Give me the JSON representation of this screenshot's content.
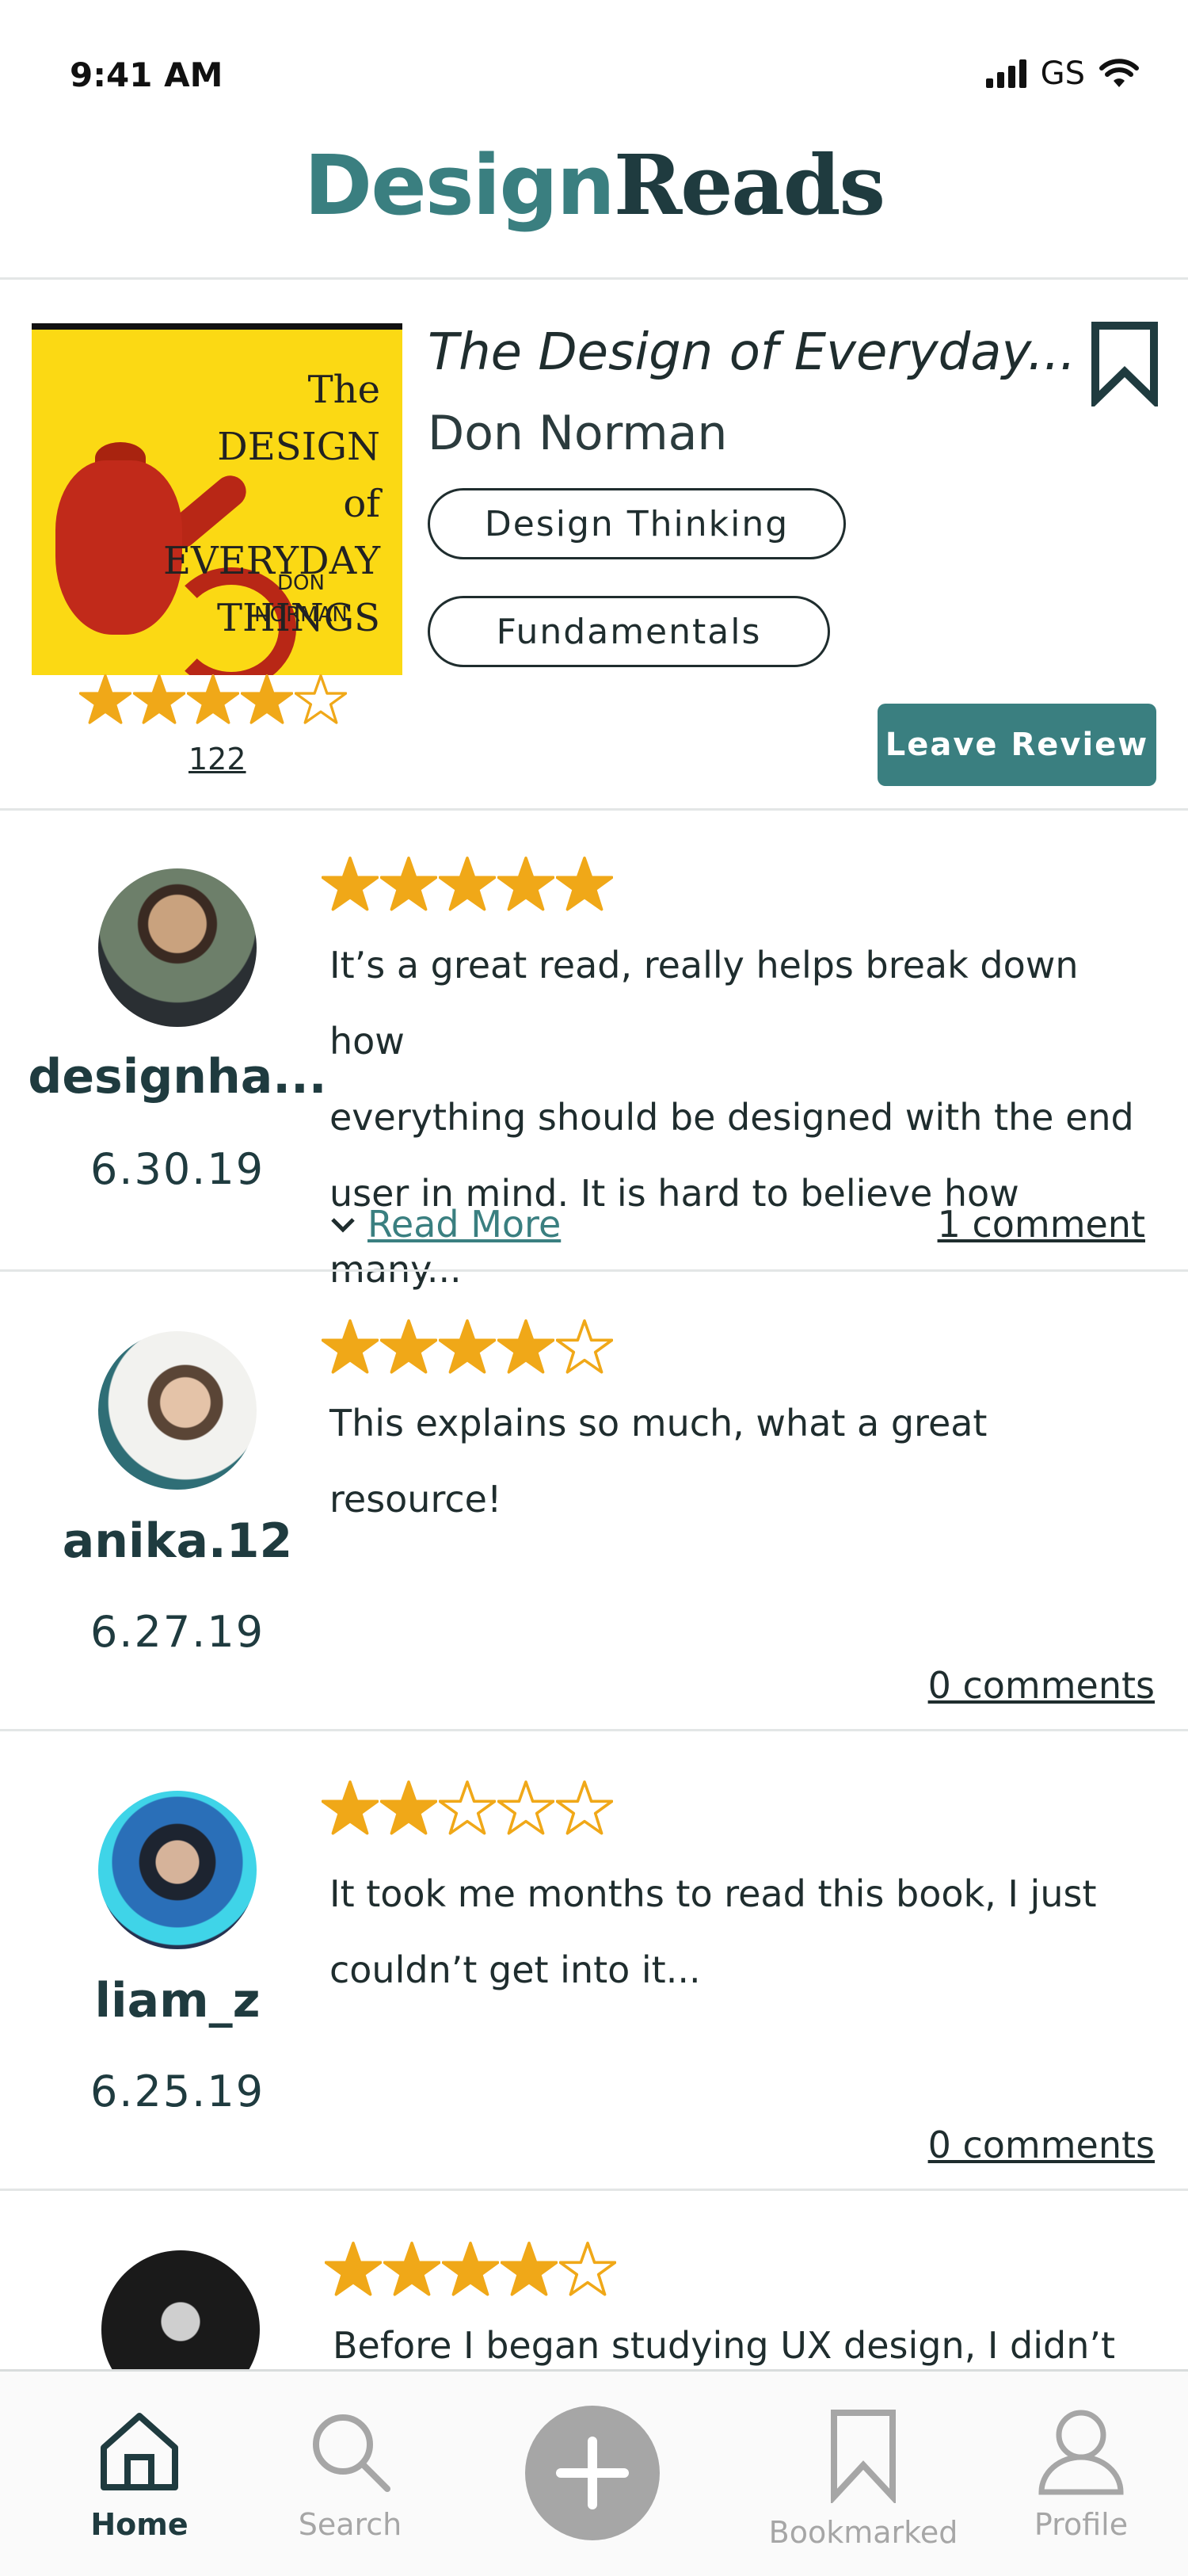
{
  "status": {
    "time": "9:41 AM",
    "carrier": "GS"
  },
  "app": {
    "title_part1": "Design",
    "title_part2": "Reads"
  },
  "book": {
    "cover_title_line1": "The DESIGN",
    "cover_title_line2": "of EVERYDAY",
    "cover_title_line3": "THINGS",
    "cover_author_line1": "DON",
    "cover_author_line2": "NORMAN",
    "title": "The Design of Everyday...",
    "author": "Don Norman",
    "tags": [
      "Design Thinking",
      "Fundamentals"
    ],
    "rating": 4,
    "rating_max": 5,
    "rating_count": "122",
    "leave_review_label": "Leave Review"
  },
  "reviews": [
    {
      "username": "designha...",
      "date": "6.30.19",
      "rating": 5,
      "text_lines": [
        "It’s a great read, really helps break down how",
        "everything should be designed with the end",
        "user in mind. It is hard to believe how many..."
      ],
      "read_more": "Read More",
      "comments": "1 comment"
    },
    {
      "username": "anika.12",
      "date": "6.27.19",
      "rating": 4,
      "text_lines": [
        "This explains so much, what a great",
        "resource!"
      ],
      "comments": "0 comments"
    },
    {
      "username": "liam_z",
      "date": "6.25.19",
      "rating": 2,
      "text_lines": [
        "It took me months to read this book, I just",
        "couldn’t get into it..."
      ],
      "comments": "0 comments"
    },
    {
      "rating": 4,
      "text_lines": [
        "Before I began studying UX design, I didn’t"
      ]
    }
  ],
  "tabs": {
    "home": "Home",
    "search": "Search",
    "bookmarked": "Bookmarked",
    "profile": "Profile"
  },
  "colors": {
    "accent": "#3a7f80",
    "star": "#f0a818",
    "dark": "#1f3b3f",
    "inactive": "#a6a6a6"
  }
}
